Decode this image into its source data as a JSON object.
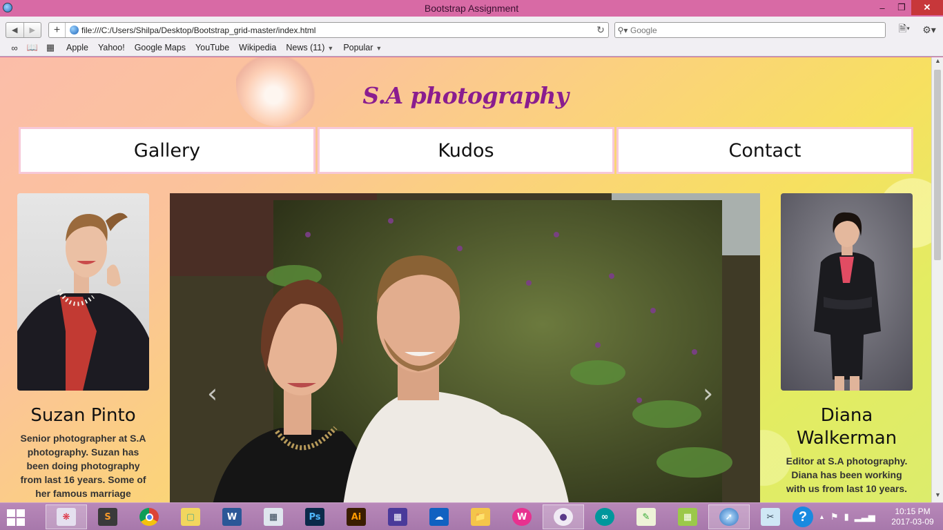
{
  "window": {
    "title": "Bootstrap Assignment"
  },
  "toolbar": {
    "url": "file:///C:/Users/Shilpa/Desktop/Bootstrap_grid-master/index.html",
    "search_placeholder": "Google"
  },
  "bookmarks": [
    {
      "label": "Apple"
    },
    {
      "label": "Yahoo!"
    },
    {
      "label": "Google Maps"
    },
    {
      "label": "YouTube"
    },
    {
      "label": "Wikipedia"
    },
    {
      "label": "News (11)"
    },
    {
      "label": "Popular"
    }
  ],
  "site": {
    "title": "S.A photography",
    "nav": [
      "Gallery",
      "Kudos",
      "Contact"
    ],
    "left_profile": {
      "name": "Suzan Pinto",
      "bio": "Senior photographer at S.A photography. Suzan has been doing photography from last 16 years. Some of her famous marriage"
    },
    "right_profile": {
      "name": "Diana Walkerman",
      "bio": "Editor at S.A photography. Diana has been working with us from last 10 years."
    }
  },
  "taskbar": {
    "time": "10:15 PM",
    "date": "2017-03-09",
    "apps": [
      "paint-icon",
      "sublime-text-icon",
      "chrome-icon",
      "file-manager-icon",
      "word-icon",
      "calculator-icon",
      "photoshop-icon",
      "illustrator-icon",
      "calendar-icon",
      "onedrive-icon",
      "folder-icon",
      "webstorm-icon",
      "github-icon",
      "arduino-icon",
      "notepad-icon",
      "project-icon",
      "safari-icon",
      "snipping-icon"
    ]
  },
  "colors": {
    "title_purple": "#8a1d8f",
    "window_frame": "#d86aa5",
    "nav_border": "#f7c8d8"
  }
}
